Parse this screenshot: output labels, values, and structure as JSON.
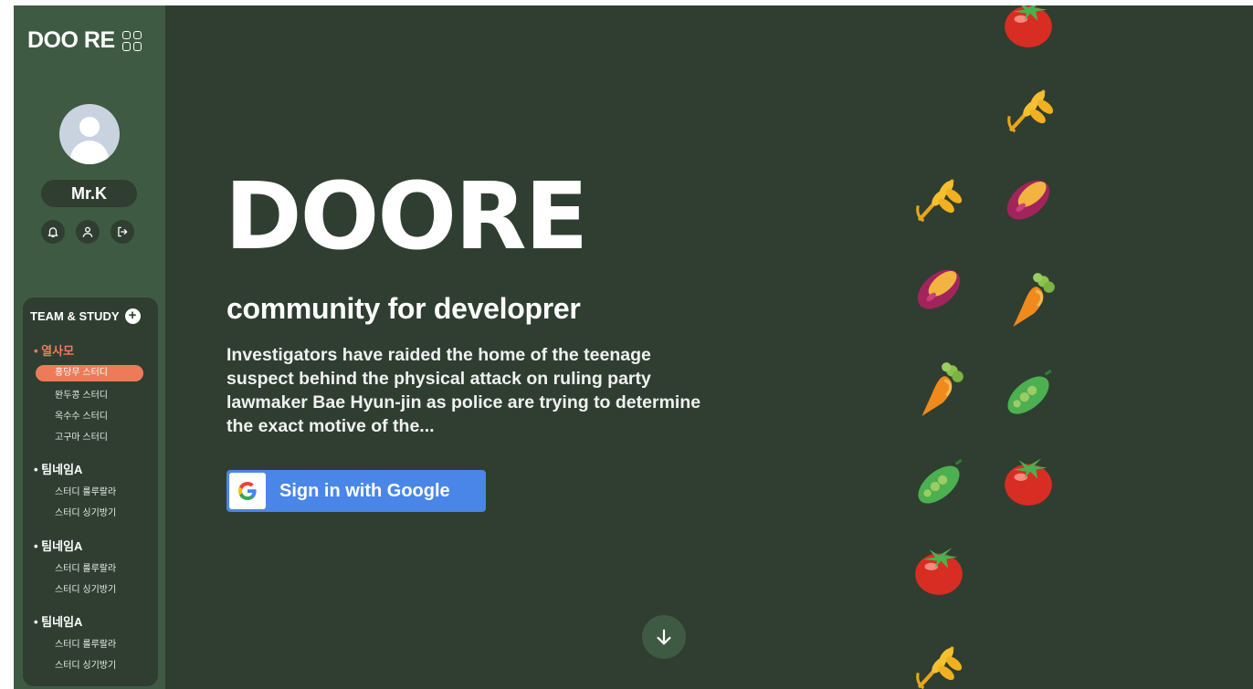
{
  "sidebar": {
    "logo": "DOO RE",
    "username": "Mr.K",
    "team_title": "TEAM & STUDY",
    "groups": [
      {
        "name": "• 열사모",
        "items": [
          "홍당무 스터디",
          "완두콩 스터디",
          "옥수수 스터디",
          "고구마 스터디"
        ],
        "active_item": 0
      },
      {
        "name": "• 팀네임A",
        "items": [
          "스터디 룰루랄라",
          "스터디 싱기방기"
        ]
      },
      {
        "name": "• 팀네임A",
        "items": [
          "스터디 룰루랄라",
          "스터디 싱기방기"
        ]
      },
      {
        "name": "• 팀네임A",
        "items": [
          "스터디 룰루랄라",
          "스터디 싱기방기"
        ]
      }
    ]
  },
  "hero": {
    "title": "DOORE",
    "subtitle": "community for developrer",
    "description": "Investigators have raided the home of the teenage suspect behind the physical attack on ruling party lawmaker Bae Hyun-jin as police are trying to determine the exact motive of the...",
    "google_button": "Sign in with Google"
  },
  "icons": {
    "grid": "grid-icon",
    "bell": "bell-icon",
    "profile": "user-icon",
    "logout": "logout-icon",
    "add": "plus-icon",
    "scroll": "arrow-down-icon",
    "google": "google-icon"
  },
  "colors": {
    "background": "#2f3e31",
    "sidebar": "#3f5a42",
    "accent": "#ee7a5a",
    "google_blue": "#4a86e8"
  },
  "veggies": [
    "tomato",
    "wheat",
    "wheat",
    "sweet-potato",
    "sweet-potato",
    "carrot",
    "carrot",
    "pea",
    "pea",
    "tomato",
    "tomato",
    "wheat"
  ]
}
